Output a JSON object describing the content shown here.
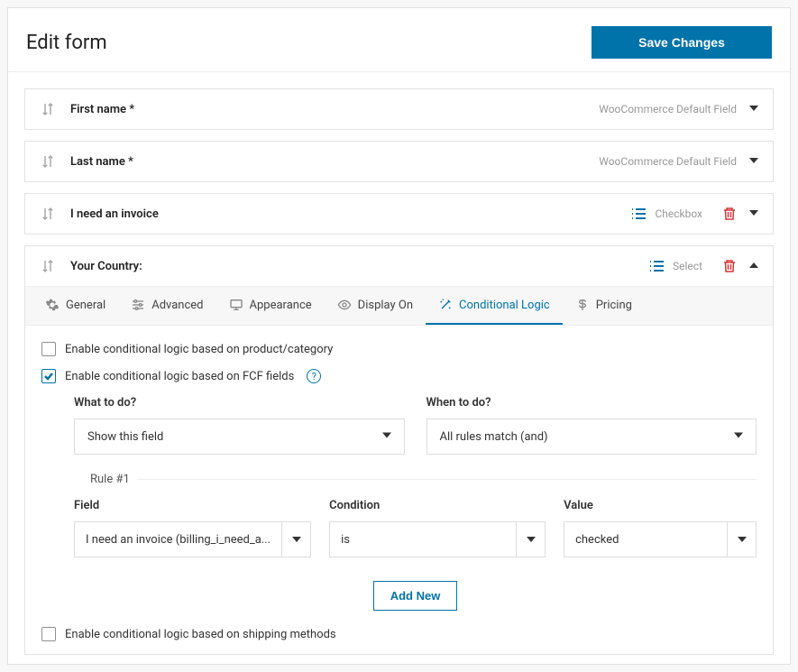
{
  "header": {
    "title": "Edit form",
    "save_label": "Save Changes"
  },
  "fields": [
    {
      "name": "First name *",
      "type_label": "WooCommerce Default Field",
      "icon": null,
      "delete": false,
      "expanded": false
    },
    {
      "name": "Last name *",
      "type_label": "WooCommerce Default Field",
      "icon": null,
      "delete": false,
      "expanded": false
    },
    {
      "name": "I need an invoice",
      "type_label": "Checkbox",
      "icon": "list",
      "delete": true,
      "expanded": false
    },
    {
      "name": "Your Country:",
      "type_label": "Select",
      "icon": "list",
      "delete": true,
      "expanded": true
    }
  ],
  "tabs": {
    "general": "General",
    "advanced": "Advanced",
    "appearance": "Appearance",
    "display_on": "Display On",
    "conditional": "Conditional Logic",
    "pricing": "Pricing"
  },
  "conditional": {
    "enable_product_label": "Enable conditional logic based on product/category",
    "enable_product_checked": false,
    "enable_fcf_label": "Enable conditional logic based on FCF fields",
    "enable_fcf_checked": true,
    "enable_shipping_label": "Enable conditional logic based on shipping methods",
    "enable_shipping_checked": false,
    "what_label": "What to do?",
    "what_value": "Show this field",
    "when_label": "When to do?",
    "when_value": "All rules match (and)",
    "rule_legend": "Rule #1",
    "rule_field_label": "Field",
    "rule_field_value": "I need an invoice (billing_i_need_a...",
    "rule_cond_label": "Condition",
    "rule_cond_value": "is",
    "rule_value_label": "Value",
    "rule_value_value": "checked",
    "add_new_label": "Add New"
  }
}
